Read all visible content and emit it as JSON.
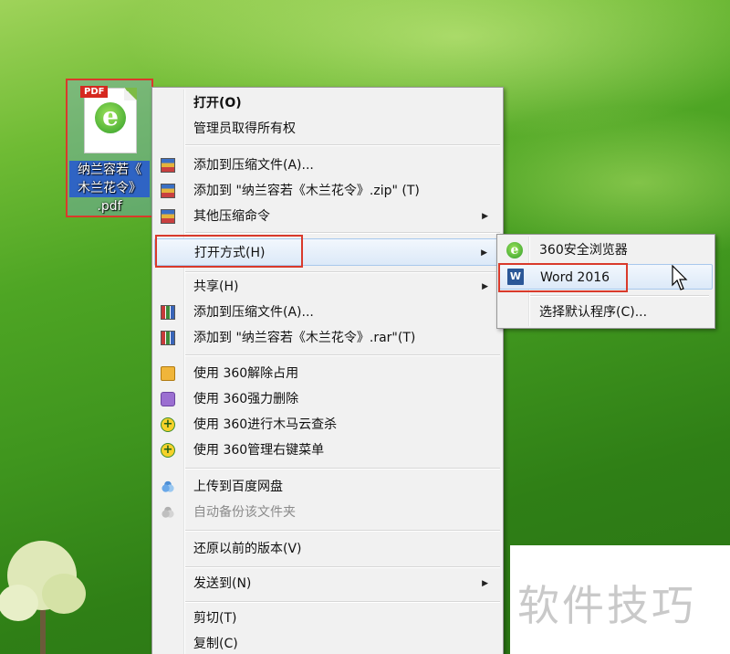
{
  "file": {
    "badge": "PDF",
    "name_lines": [
      "纳兰容若《",
      "木兰花令》",
      ".pdf"
    ]
  },
  "context_menu": {
    "items": [
      {
        "label": "打开(O)"
      },
      {
        "label": "管理员取得所有权"
      },
      {
        "label": "添加到压缩文件(A)..."
      },
      {
        "label": "添加到 \"纳兰容若《木兰花令》.zip\" (T)"
      },
      {
        "label": "其他压缩命令"
      },
      {
        "label": "打开方式(H)"
      },
      {
        "label": "共享(H)"
      },
      {
        "label": "添加到压缩文件(A)..."
      },
      {
        "label": "添加到 \"纳兰容若《木兰花令》.rar\"(T)"
      },
      {
        "label": "使用 360解除占用"
      },
      {
        "label": "使用 360强力删除"
      },
      {
        "label": "使用 360进行木马云查杀"
      },
      {
        "label": "使用 360管理右键菜单"
      },
      {
        "label": "上传到百度网盘"
      },
      {
        "label": "自动备份该文件夹"
      },
      {
        "label": "还原以前的版本(V)"
      },
      {
        "label": "发送到(N)"
      },
      {
        "label": "剪切(T)"
      },
      {
        "label": "复制(C)"
      }
    ],
    "submenu_arrow": "▶"
  },
  "open_with_submenu": {
    "items": [
      {
        "label": "360安全浏览器"
      },
      {
        "label": "Word 2016"
      },
      {
        "label": "选择默认程序(C)..."
      }
    ]
  },
  "icons": {
    "word": "W",
    "browser": "e",
    "plus_360": "+"
  },
  "watermark": "软件技巧",
  "colors": {
    "highlight_box": "#d93a2b",
    "hover_fill": "#dce9f8",
    "menu_bg": "#f1f1f1"
  }
}
